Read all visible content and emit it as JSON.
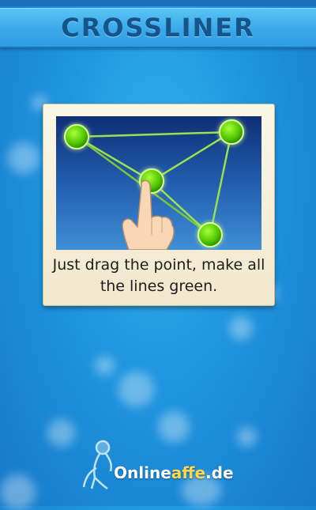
{
  "header": {
    "title": "CROSSLINER"
  },
  "tutorial": {
    "caption_line1": "Just drag the point, make all",
    "caption_line2": "the lines green."
  },
  "logo": {
    "part1": "Online",
    "part2": "affe",
    "part3": ".de"
  },
  "colors": {
    "background": "#1f95e0",
    "header": "#3aa9ea",
    "title": "#17548a",
    "node": "#5fd400",
    "line": "#7dd63a",
    "card": "#f6eed8"
  },
  "icons": [
    "hand-pointer-icon",
    "monkey-icon"
  ]
}
